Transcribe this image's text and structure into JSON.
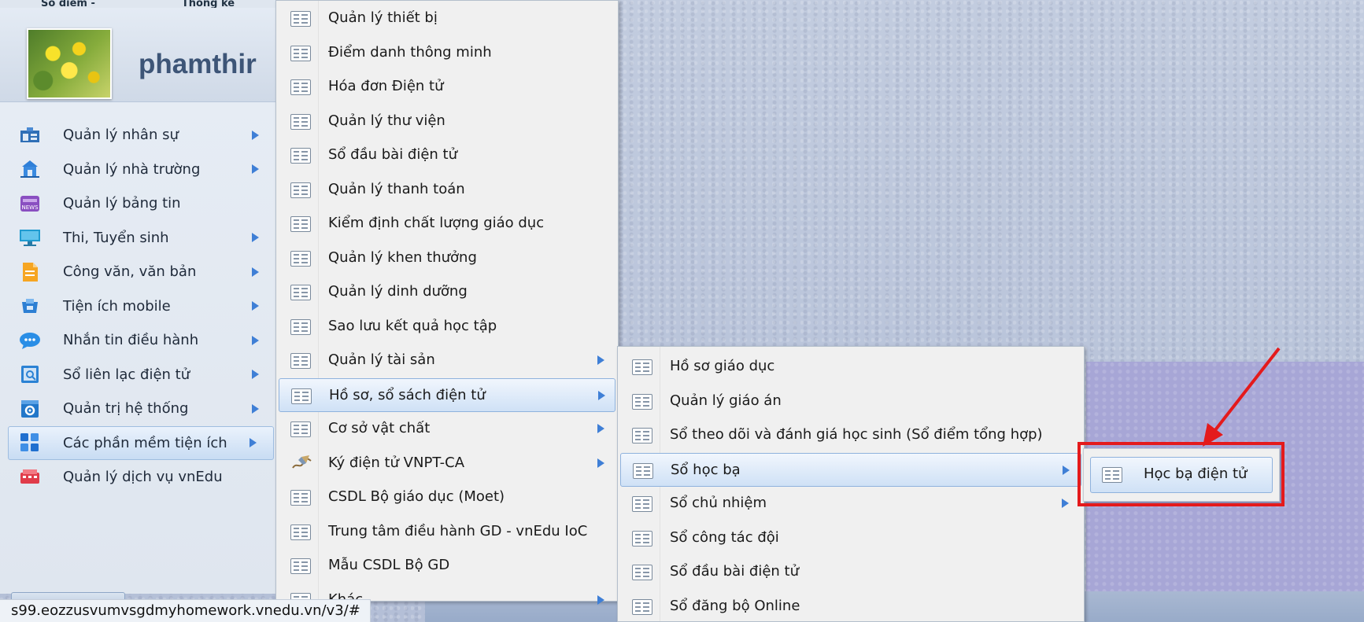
{
  "top_strip": {
    "left_text": "Sổ điểm -",
    "right_text": "Thống kê"
  },
  "user": {
    "name": "phamthir"
  },
  "left_menu": [
    {
      "label": "Quản lý nhân sự",
      "icon": "staff-icon",
      "has_submenu": true
    },
    {
      "label": "Quản lý nhà trường",
      "icon": "school-icon",
      "has_submenu": true
    },
    {
      "label": "Quản lý bảng tin",
      "icon": "news-icon",
      "has_submenu": false
    },
    {
      "label": "Thi, Tuyển sinh",
      "icon": "exam-icon",
      "has_submenu": true
    },
    {
      "label": "Công văn, văn bản",
      "icon": "document-icon",
      "has_submenu": true
    },
    {
      "label": "Tiện ích mobile",
      "icon": "mobile-icon",
      "has_submenu": true
    },
    {
      "label": "Nhắn tin điều hành",
      "icon": "chat-icon",
      "has_submenu": true
    },
    {
      "label": "Sổ liên lạc điện tử",
      "icon": "contact-book-icon",
      "has_submenu": true
    },
    {
      "label": "Quản trị hệ thống",
      "icon": "system-admin-icon",
      "has_submenu": true
    },
    {
      "label": "Các phần mềm tiện ích",
      "icon": "apps-grid-icon",
      "has_submenu": true,
      "active": true
    },
    {
      "label": "Quản lý dịch vụ vnEdu",
      "icon": "service-icon",
      "has_submenu": false
    }
  ],
  "submenu_1": [
    {
      "label": "Quản lý thiết bị"
    },
    {
      "label": "Điểm danh thông minh"
    },
    {
      "label": "Hóa đơn Điện tử"
    },
    {
      "label": "Quản lý thư viện"
    },
    {
      "label": "Sổ đầu bài điện tử"
    },
    {
      "label": "Quản lý thanh toán"
    },
    {
      "label": "Kiểm định chất lượng giáo dục"
    },
    {
      "label": "Quản lý khen thưởng"
    },
    {
      "label": "Quản lý dinh dưỡng"
    },
    {
      "label": "Sao lưu kết quả học tập"
    },
    {
      "label": "Quản lý tài sản",
      "has_submenu": true
    },
    {
      "label": "Hồ sơ, sổ sách điện tử",
      "has_submenu": true,
      "active": true
    },
    {
      "label": "Cơ sở vật chất",
      "has_submenu": true
    },
    {
      "label": "Ký điện tử VNPT-CA",
      "has_submenu": true,
      "icon": "signature-pen-icon"
    },
    {
      "label": "CSDL Bộ giáo dục (Moet)"
    },
    {
      "label": "Trung tâm điều hành GD - vnEdu IoC"
    },
    {
      "label": "Mẫu CSDL Bộ GD"
    },
    {
      "label": "Khác",
      "has_submenu": true
    }
  ],
  "submenu_2": [
    {
      "label": "Hồ sơ giáo dục"
    },
    {
      "label": "Quản lý giáo án"
    },
    {
      "label": "Sổ theo dõi và đánh giá học sinh (Sổ điểm tổng hợp)"
    },
    {
      "label": "Sổ học bạ",
      "has_submenu": true,
      "active": true
    },
    {
      "label": "Sổ chủ nhiệm",
      "has_submenu": true
    },
    {
      "label": "Sổ công tác đội"
    },
    {
      "label": "Sổ đầu bài điện tử"
    },
    {
      "label": "Sổ đăng bộ Online"
    }
  ],
  "submenu_3": [
    {
      "label": "Học bạ điện tử",
      "active": true
    }
  ],
  "status_bar": {
    "url": "s99.eozzusvumvsgdmyhomework.vnedu.vn/v3/#"
  },
  "colors": {
    "highlight": "#e41a1c",
    "menu_arrow": "#3f7fd6",
    "active_item": "#cfe1f6"
  }
}
